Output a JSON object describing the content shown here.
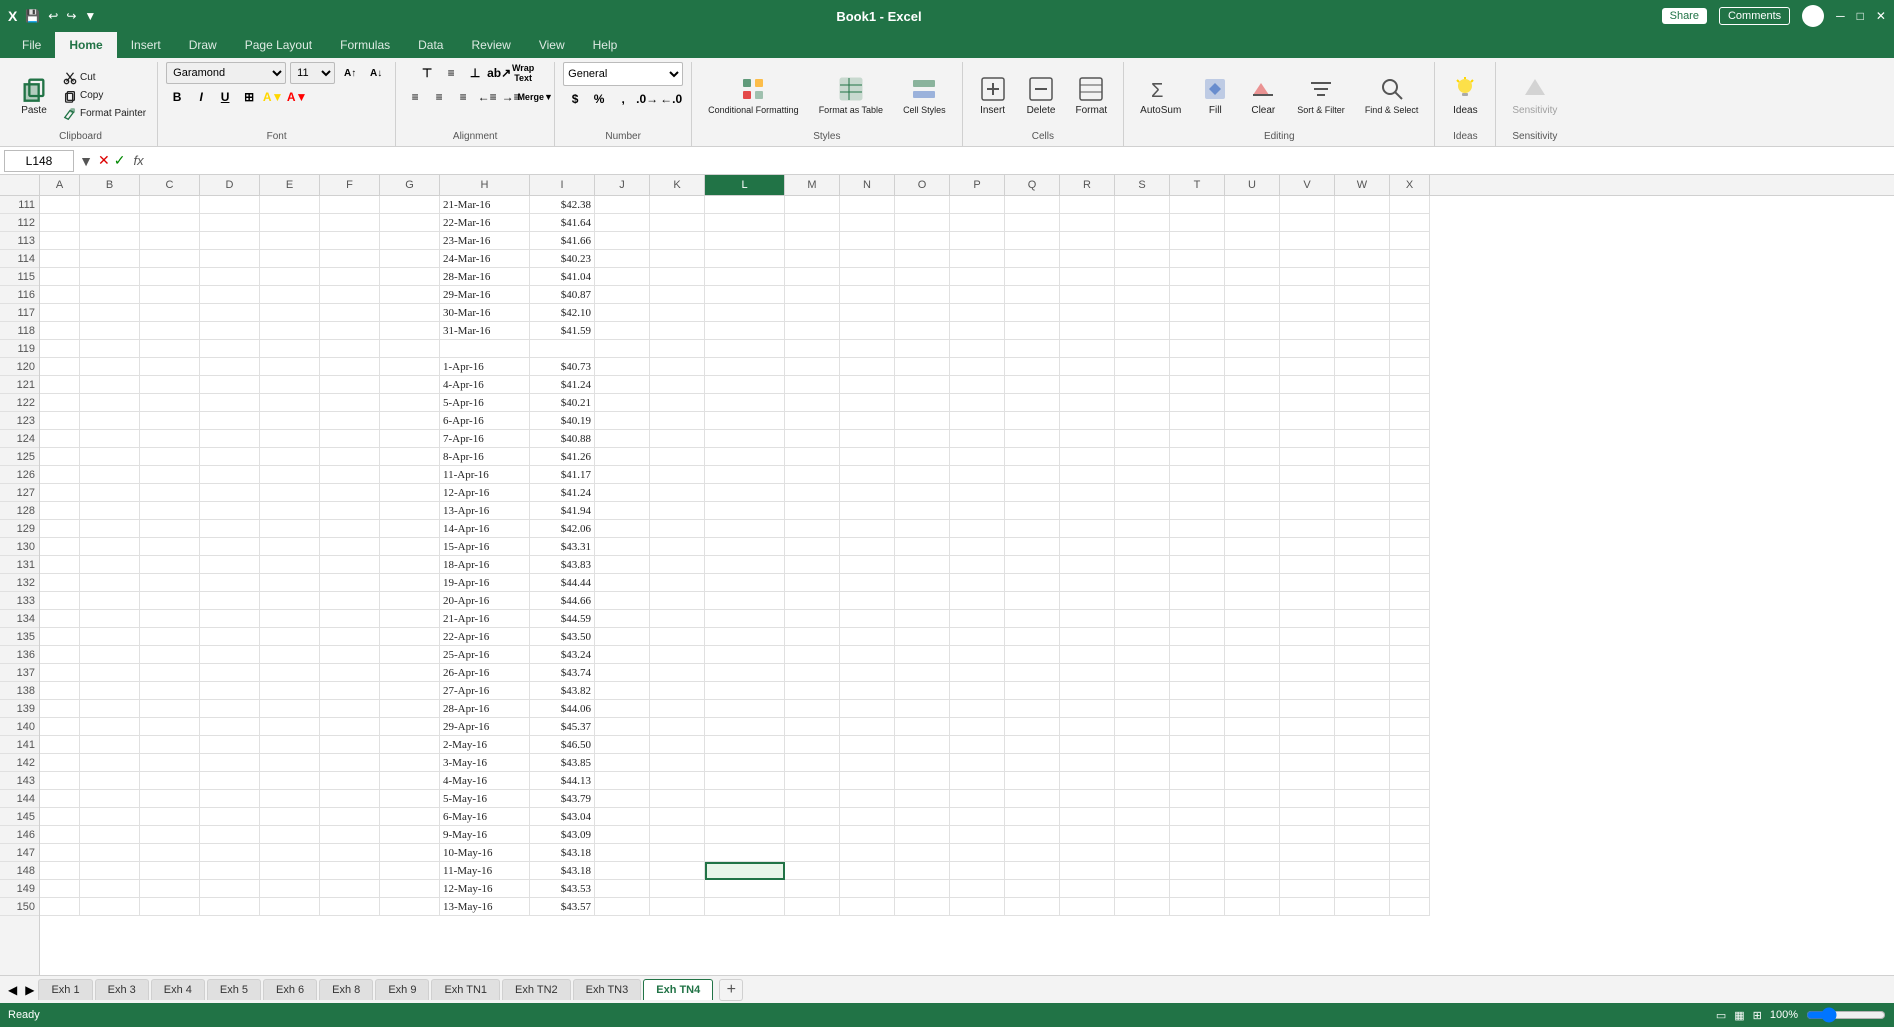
{
  "app": {
    "title": "Excel",
    "filename": "Book1 - Excel"
  },
  "title_bar": {
    "actions": [
      "minimize",
      "restore",
      "close"
    ],
    "share_label": "Share",
    "comments_label": "Comments"
  },
  "ribbon": {
    "tabs": [
      "File",
      "Home",
      "Insert",
      "Draw",
      "Page Layout",
      "Formulas",
      "Data",
      "Review",
      "View",
      "Help"
    ],
    "active_tab": "Home",
    "groups": {
      "clipboard": {
        "label": "Clipboard",
        "paste_label": "Paste",
        "cut_label": "Cut",
        "copy_label": "Copy",
        "format_painter_label": "Format Painter"
      },
      "font": {
        "label": "Font",
        "font_name": "Garamond",
        "font_size": "11",
        "bold_label": "B",
        "italic_label": "I",
        "underline_label": "U"
      },
      "alignment": {
        "label": "Alignment",
        "wrap_text_label": "Wrap Text",
        "merge_center_label": "Merge & Center"
      },
      "number": {
        "label": "Number",
        "format_label": "General"
      },
      "styles": {
        "label": "Styles",
        "conditional_formatting_label": "Conditional Formatting",
        "format_as_table_label": "Format as Table",
        "cell_styles_label": "Cell Styles"
      },
      "cells": {
        "label": "Cells",
        "insert_label": "Insert",
        "delete_label": "Delete",
        "format_label": "Format"
      },
      "editing": {
        "label": "Editing",
        "autosum_label": "AutoSum",
        "fill_label": "Fill",
        "clear_label": "Clear",
        "sort_filter_label": "Sort & Filter",
        "find_select_label": "Find & Select"
      },
      "ideas": {
        "label": "Ideas",
        "ideas_label": "Ideas"
      },
      "sensitivity": {
        "label": "Sensitivity",
        "sensitivity_label": "Sensitivity"
      }
    }
  },
  "formula_bar": {
    "cell_ref": "L148",
    "formula": ""
  },
  "columns": [
    "A",
    "B",
    "C",
    "D",
    "E",
    "F",
    "G",
    "H",
    "I",
    "J",
    "K",
    "L",
    "M",
    "N",
    "O",
    "P",
    "Q",
    "R",
    "S",
    "T",
    "U",
    "V",
    "W",
    "X"
  ],
  "active_col": "L",
  "active_row": 148,
  "rows": [
    {
      "num": 111,
      "h": "21-Mar-16",
      "i": "$42.38"
    },
    {
      "num": 112,
      "h": "22-Mar-16",
      "i": "$41.64"
    },
    {
      "num": 113,
      "h": "23-Mar-16",
      "i": "$41.66"
    },
    {
      "num": 114,
      "h": "24-Mar-16",
      "i": "$40.23"
    },
    {
      "num": 115,
      "h": "28-Mar-16",
      "i": "$41.04"
    },
    {
      "num": 116,
      "h": "29-Mar-16",
      "i": "$40.87"
    },
    {
      "num": 117,
      "h": "30-Mar-16",
      "i": "$42.10"
    },
    {
      "num": 118,
      "h": "31-Mar-16",
      "i": "$41.59"
    },
    {
      "num": 119,
      "h": "",
      "i": ""
    },
    {
      "num": 120,
      "h": "1-Apr-16",
      "i": "$40.73"
    },
    {
      "num": 121,
      "h": "4-Apr-16",
      "i": "$41.24"
    },
    {
      "num": 122,
      "h": "5-Apr-16",
      "i": "$40.21"
    },
    {
      "num": 123,
      "h": "6-Apr-16",
      "i": "$40.19"
    },
    {
      "num": 124,
      "h": "7-Apr-16",
      "i": "$40.88"
    },
    {
      "num": 125,
      "h": "8-Apr-16",
      "i": "$41.26"
    },
    {
      "num": 126,
      "h": "11-Apr-16",
      "i": "$41.17"
    },
    {
      "num": 127,
      "h": "12-Apr-16",
      "i": "$41.24"
    },
    {
      "num": 128,
      "h": "13-Apr-16",
      "i": "$41.94"
    },
    {
      "num": 129,
      "h": "14-Apr-16",
      "i": "$42.06"
    },
    {
      "num": 130,
      "h": "15-Apr-16",
      "i": "$43.31"
    },
    {
      "num": 131,
      "h": "18-Apr-16",
      "i": "$43.83"
    },
    {
      "num": 132,
      "h": "19-Apr-16",
      "i": "$44.44"
    },
    {
      "num": 133,
      "h": "20-Apr-16",
      "i": "$44.66"
    },
    {
      "num": 134,
      "h": "21-Apr-16",
      "i": "$44.59"
    },
    {
      "num": 135,
      "h": "22-Apr-16",
      "i": "$43.50"
    },
    {
      "num": 136,
      "h": "25-Apr-16",
      "i": "$43.24"
    },
    {
      "num": 137,
      "h": "26-Apr-16",
      "i": "$43.74"
    },
    {
      "num": 138,
      "h": "27-Apr-16",
      "i": "$43.82"
    },
    {
      "num": 139,
      "h": "28-Apr-16",
      "i": "$44.06"
    },
    {
      "num": 140,
      "h": "29-Apr-16",
      "i": "$45.37"
    },
    {
      "num": 141,
      "h": "2-May-16",
      "i": "$46.50"
    },
    {
      "num": 142,
      "h": "3-May-16",
      "i": "$43.85"
    },
    {
      "num": 143,
      "h": "4-May-16",
      "i": "$44.13"
    },
    {
      "num": 144,
      "h": "5-May-16",
      "i": "$43.79"
    },
    {
      "num": 145,
      "h": "6-May-16",
      "i": "$43.04"
    },
    {
      "num": 146,
      "h": "9-May-16",
      "i": "$43.09"
    },
    {
      "num": 147,
      "h": "10-May-16",
      "i": "$43.18"
    },
    {
      "num": 148,
      "h": "11-May-16",
      "i": "$43.18",
      "l_selected": true
    },
    {
      "num": 149,
      "h": "12-May-16",
      "i": "$43.53"
    },
    {
      "num": 150,
      "h": "13-May-16",
      "i": "$43.57"
    }
  ],
  "sheet_tabs": [
    {
      "label": "Exh 1",
      "active": false
    },
    {
      "label": "Exh 3",
      "active": false
    },
    {
      "label": "Exh 4",
      "active": false
    },
    {
      "label": "Exh 5",
      "active": false
    },
    {
      "label": "Exh 6",
      "active": false
    },
    {
      "label": "Exh 8",
      "active": false
    },
    {
      "label": "Exh 9",
      "active": false
    },
    {
      "label": "Exh TN1",
      "active": false
    },
    {
      "label": "Exh TN2",
      "active": false
    },
    {
      "label": "Exh TN3",
      "active": false
    },
    {
      "label": "Exh TN4",
      "active": true
    }
  ],
  "status_bar": {
    "ready": "Ready",
    "view_normal": "Normal",
    "zoom": "100%"
  }
}
